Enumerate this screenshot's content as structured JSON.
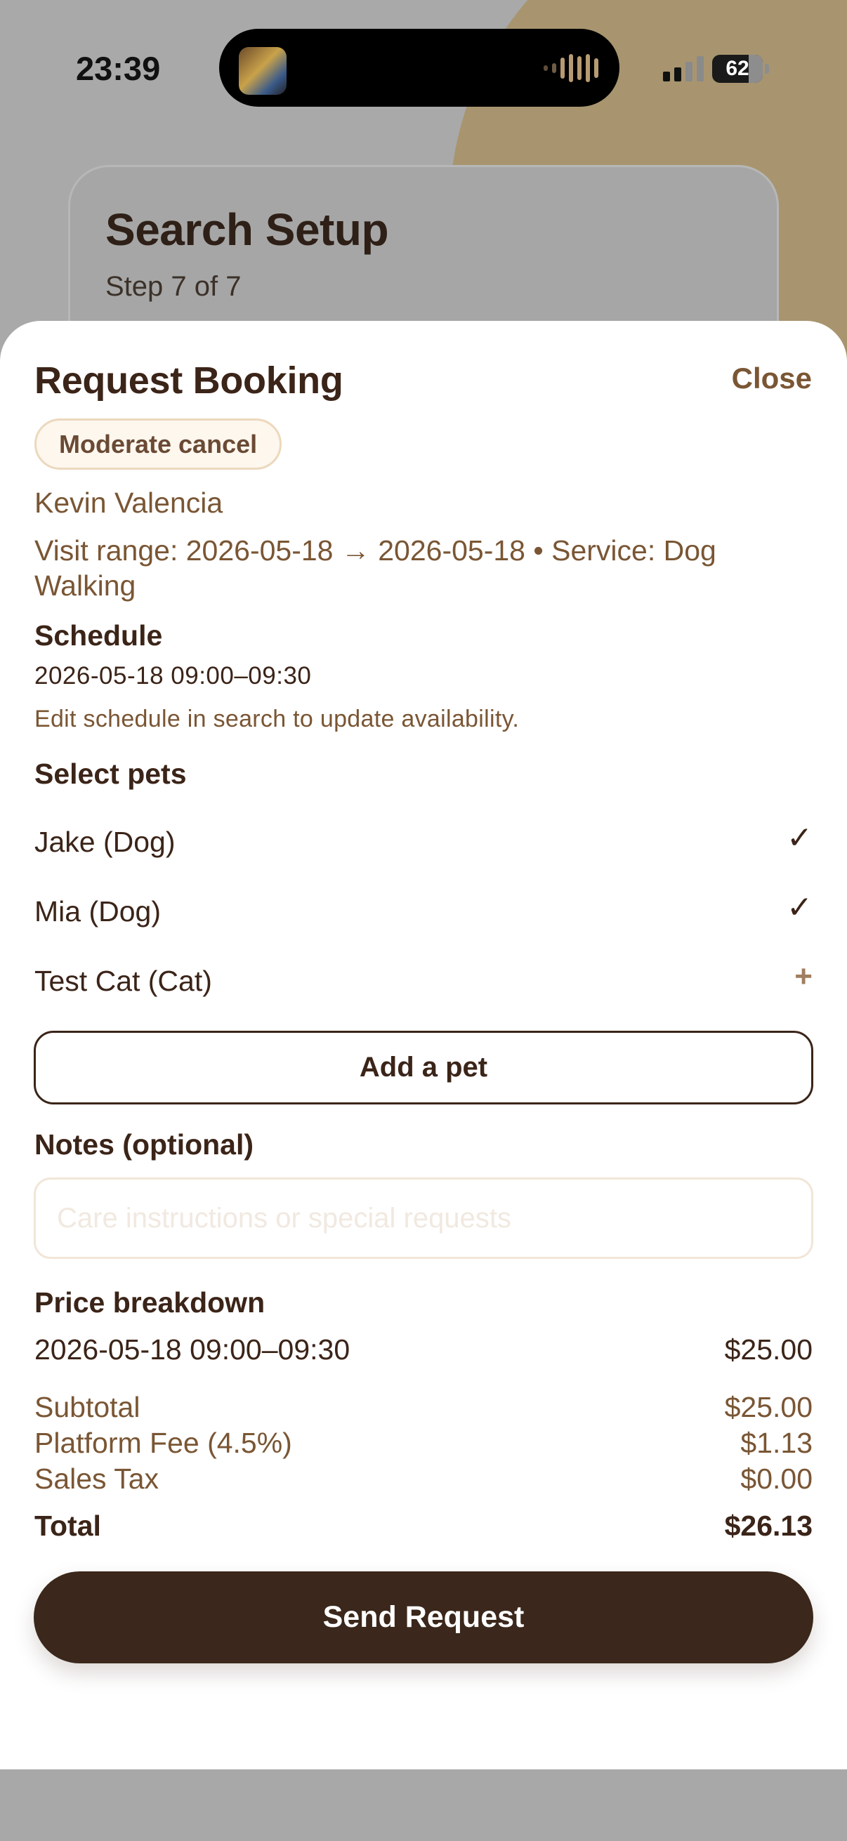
{
  "status_bar": {
    "time": "23:39",
    "battery": "62"
  },
  "background_card": {
    "title": "Search Setup",
    "step": "Step 7 of 7"
  },
  "sheet": {
    "title": "Request Booking",
    "close_label": "Close",
    "cancel_policy_badge": "Moderate cancel",
    "sitter_name": "Kevin Valencia",
    "visit_range": "Visit range: 2026-05-18 → 2026-05-18 • Service: Dog Walking"
  },
  "schedule": {
    "heading": "Schedule",
    "slot": "2026-05-18 09:00–09:30",
    "hint": "Edit schedule in search to update availability."
  },
  "pets": {
    "heading": "Select pets",
    "items": [
      {
        "label": "Jake (Dog)",
        "selected": true,
        "indicator": "✓"
      },
      {
        "label": "Mia (Dog)",
        "selected": true,
        "indicator": "✓"
      },
      {
        "label": "Test Cat (Cat)",
        "selected": false,
        "indicator": "+"
      }
    ],
    "add_label": "Add a pet"
  },
  "notes": {
    "heading": "Notes (optional)",
    "placeholder": "Care instructions or special requests",
    "value": ""
  },
  "price": {
    "heading": "Price breakdown",
    "line_items": [
      {
        "label": "2026-05-18 09:00–09:30",
        "amount": "$25.00"
      }
    ],
    "subtotal_label": "Subtotal",
    "subtotal": "$25.00",
    "fee_label": "Platform Fee (4.5%)",
    "fee": "$1.13",
    "tax_label": "Sales Tax",
    "tax": "$0.00",
    "total_label": "Total",
    "total": "$26.13"
  },
  "actions": {
    "send_label": "Send Request"
  },
  "colors": {
    "brand_dark": "#3b271b",
    "accent_brown": "#7a5634",
    "badge_border": "#ecd8bd"
  }
}
